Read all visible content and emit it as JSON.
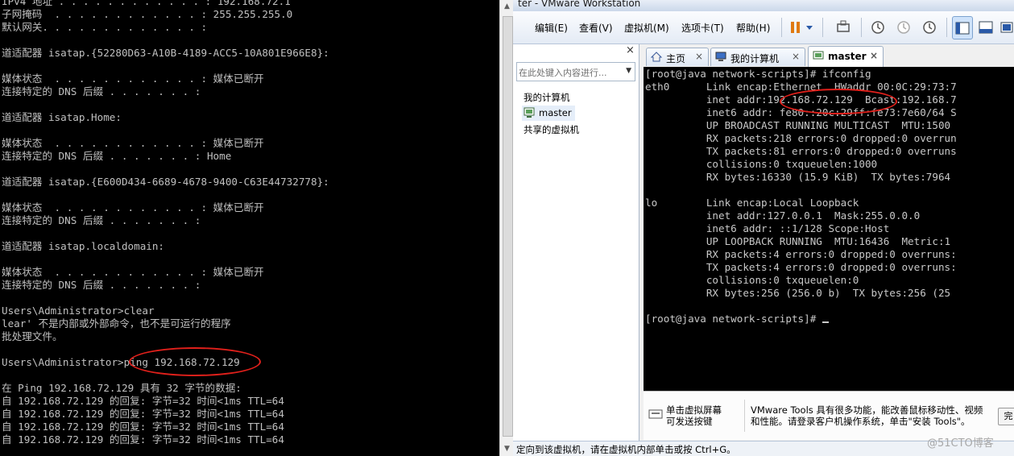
{
  "cmd_window": {
    "lines": [
      "IPv4 地址 . . . . . . . . . . . . : 192.168.72.1",
      "子网掩码  . . . . . . . . . . . . : 255.255.255.0",
      "默认网关. . . . . . . . . . . . . :",
      "",
      "道适配器 isatap.{52280D63-A10B-4189-ACC5-10A801E966E8}:",
      "",
      "媒体状态  . . . . . . . . . . . . : 媒体已断开",
      "连接特定的 DNS 后缀 . . . . . . . :",
      "",
      "道适配器 isatap.Home:",
      "",
      "媒体状态  . . . . . . . . . . . . : 媒体已断开",
      "连接特定的 DNS 后缀 . . . . . . . : Home",
      "",
      "道适配器 isatap.{E600D434-6689-4678-9400-C63E44732778}:",
      "",
      "媒体状态  . . . . . . . . . . . . : 媒体已断开",
      "连接特定的 DNS 后缀 . . . . . . . :",
      "",
      "道适配器 isatap.localdomain:",
      "",
      "媒体状态  . . . . . . . . . . . . : 媒体已断开",
      "连接特定的 DNS 后缀 . . . . . . . :",
      "",
      "Users\\Administrator>clear",
      "lear' 不是内部或外部命令，也不是可运行的程序",
      "批处理文件。",
      "",
      "Users\\Administrator>ping 192.168.72.129",
      "",
      "在 Ping 192.168.72.129 具有 32 字节的数据:",
      "自 192.168.72.129 的回复: 字节=32 时间<1ms TTL=64",
      "自 192.168.72.129 的回复: 字节=32 时间<1ms TTL=64",
      "自 192.168.72.129 的回复: 字节=32 时间<1ms TTL=64",
      "自 192.168.72.129 的回复: 字节=32 时间<1ms TTL=64"
    ]
  },
  "vmware": {
    "title": "ter - VMware Workstation",
    "menu": [
      "编辑(E)",
      "查看(V)",
      "虚拟机(M)",
      "选项卡(T)",
      "帮助(H)"
    ],
    "library": {
      "close": "×",
      "search_placeholder": "在此处键入内容进行...",
      "items": [
        "我的计算机",
        "master",
        "共享的虚拟机"
      ]
    },
    "tabs": [
      {
        "label": "主页"
      },
      {
        "label": "我的计算机"
      },
      {
        "label": "master"
      }
    ],
    "console_lines": [
      "[root@java network-scripts]# ifconfig",
      "eth0      Link encap:Ethernet  HWaddr 00:0C:29:73:7",
      "          inet addr:192.168.72.129  Bcast:192.168.7",
      "          inet6 addr: fe80::20c:29ff:fe73:7e60/64 S",
      "          UP BROADCAST RUNNING MULTICAST  MTU:1500",
      "          RX packets:218 errors:0 dropped:0 overrun",
      "          TX packets:81 errors:0 dropped:0 overruns",
      "          collisions:0 txqueuelen:1000",
      "          RX bytes:16330 (15.9 KiB)  TX bytes:7964",
      "",
      "lo        Link encap:Local Loopback",
      "          inet addr:127.0.0.1  Mask:255.0.0.0",
      "          inet6 addr: ::1/128 Scope:Host",
      "          UP LOOPBACK RUNNING  MTU:16436  Metric:1",
      "          RX packets:4 errors:0 dropped:0 overruns:",
      "          TX packets:4 errors:0 dropped:0 overruns:",
      "          collisions:0 txqueuelen:0",
      "          RX bytes:256 (256.0 b)  TX bytes:256 (25",
      "",
      "[root@java network-scripts]# "
    ],
    "notification": {
      "left_text": "单击虚拟屏幕\n可发送按键",
      "right_text": "VMware Tools 具有很多功能，能改善鼠标移动性、视频\n和性能。请登录客户机操作系统，单击\"安装 Tools\"。",
      "button_label": "完"
    },
    "status_text": "定向到该虚拟机，请在虚拟机内部单击或按 Ctrl+G。"
  },
  "watermark": "@51CTO博客",
  "colors": {
    "annotation_red": "#e0201b",
    "console_bg": "#000000",
    "console_text": "#c8c8c8"
  }
}
